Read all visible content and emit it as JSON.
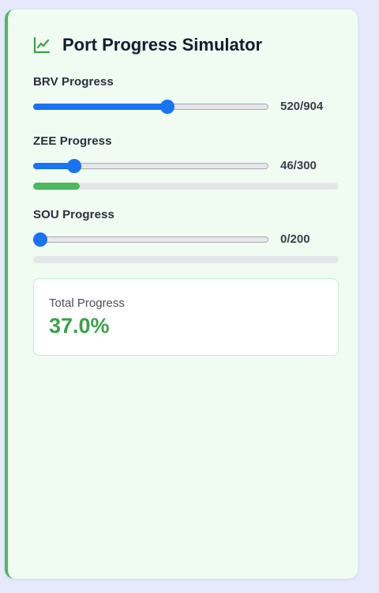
{
  "app": {
    "title": "Port Progress Simulator",
    "icon": "chart-line-icon",
    "accent": "#4cb85c",
    "slider_color": "#1a73f0"
  },
  "sliders": [
    {
      "label": "BRV Progress",
      "value": 520,
      "max": 904,
      "display": "520/904"
    },
    {
      "label": "ZEE Progress",
      "value": 46,
      "max": 300,
      "display": "46/300"
    },
    {
      "label": "SOU Progress",
      "value": 0,
      "max": 200,
      "display": "0/200"
    }
  ],
  "total": {
    "label": "Total Progress",
    "value": "37.0%"
  }
}
